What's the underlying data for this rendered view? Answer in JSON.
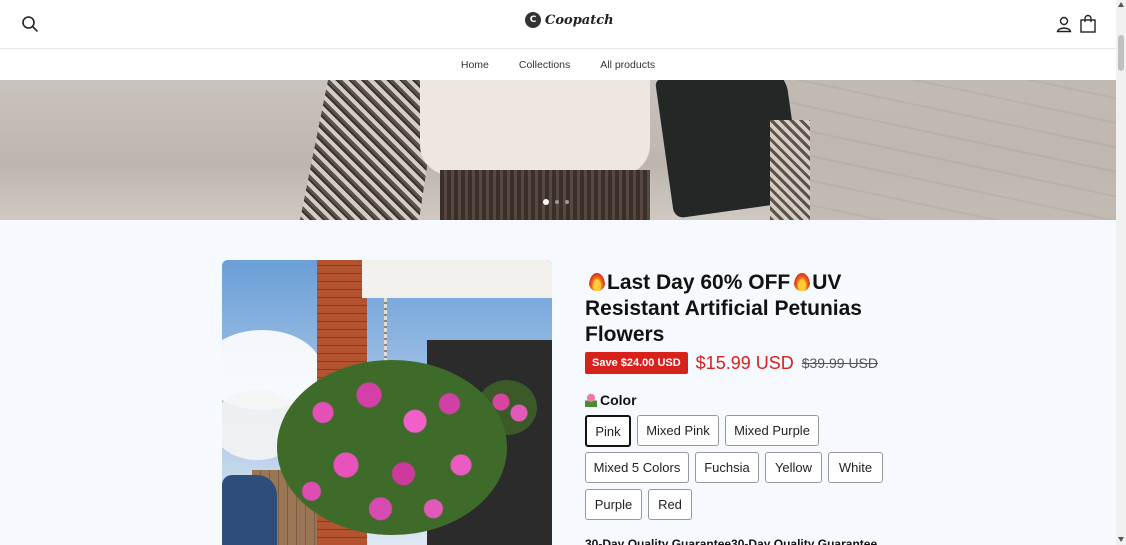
{
  "header": {
    "logo_text": "Coopatch",
    "logo_mark": "C",
    "icons": [
      "search-icon",
      "account-icon",
      "cart-icon"
    ]
  },
  "nav": {
    "items": [
      {
        "label": "Home"
      },
      {
        "label": "Collections"
      },
      {
        "label": "All products"
      }
    ]
  },
  "hero": {
    "slide_count": 3,
    "active_slide": 1
  },
  "product": {
    "title_part1": "Last Day 60% OFF",
    "title_part2": "UV Resistant Artificial Petunias Flowers",
    "save_badge": "Save $24.00 USD",
    "price": "$15.99 USD",
    "compare_price": "$39.99 USD",
    "option_label": "Color",
    "colors": [
      "Pink",
      "Mixed Pink",
      "Mixed Purple",
      "Mixed 5 Colors",
      "Fuchsia",
      "Yellow",
      "White",
      "Purple",
      "Red"
    ],
    "selected_color": "Pink",
    "guarantee_text": "30-Day Quality Guarantee30-Day Quality Guarantee"
  },
  "colors": {
    "sale_red": "#d9211c",
    "text": "#121212",
    "section_bg": "#f6f9fd"
  }
}
